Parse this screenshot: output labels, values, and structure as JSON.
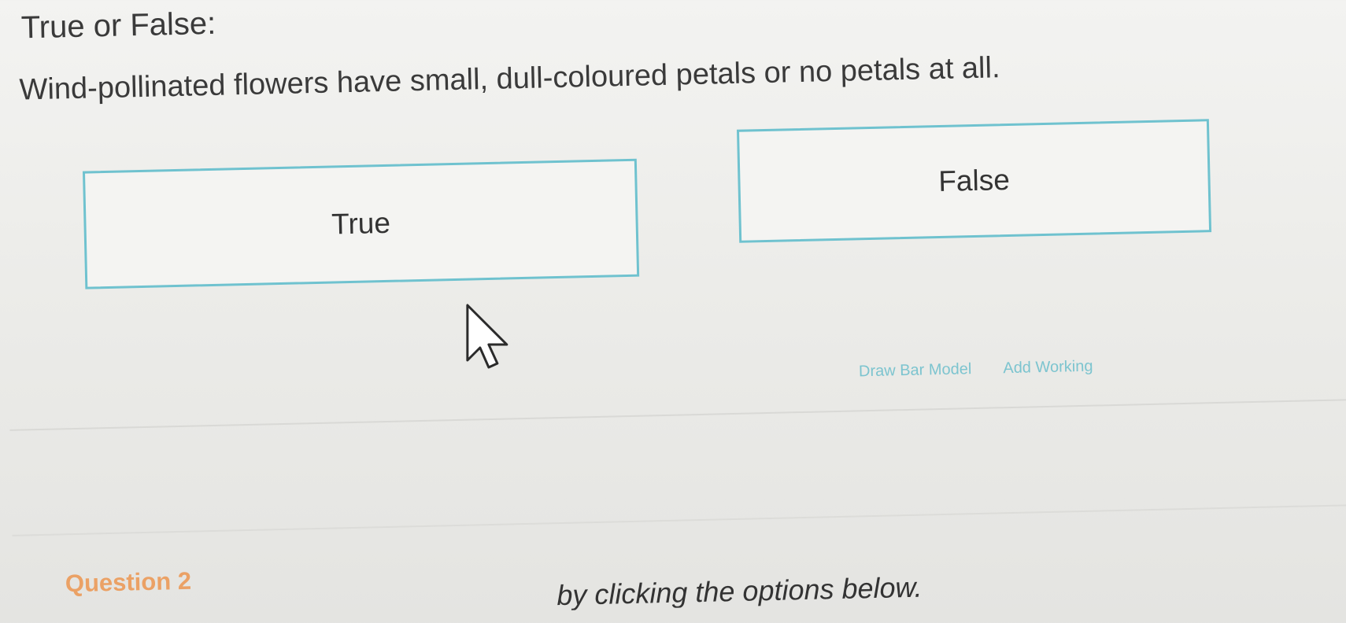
{
  "question": {
    "heading": "True or False:",
    "statement": "Wind-pollinated flowers have small, dull-coloured petals or no petals at all."
  },
  "options": [
    {
      "label": "True"
    },
    {
      "label": "False"
    }
  ],
  "tools": {
    "draw_bar_model": "Draw Bar Model",
    "add_working": "Add Working"
  },
  "next_question": {
    "label": "Question 2",
    "instruction": "by clicking the options below."
  },
  "colors": {
    "option_border": "#6fc2cf",
    "tool_link": "#7cc4cf",
    "question_label": "#eba165"
  },
  "icons": {
    "cursor": "arrow-cursor-icon"
  }
}
